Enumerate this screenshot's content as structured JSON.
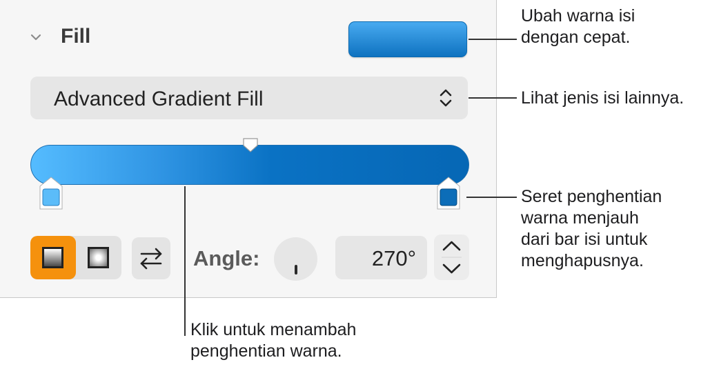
{
  "panel": {
    "section_title": "Fill",
    "fill_type": "Advanced Gradient Fill",
    "angle_label": "Angle:",
    "angle_value": "270°"
  },
  "colors": {
    "swatch_top": "#48aaf0",
    "swatch_bottom": "#0e72c0",
    "gradient_start": "#55bcff",
    "gradient_end": "#0667b5",
    "stop_left": "#5bbcf9",
    "stop_right": "#0c6db8",
    "selected_segment": "#f5910d"
  },
  "callouts": {
    "quick_fill": [
      "Ubah warna isi",
      "dengan cepat."
    ],
    "more_types": [
      "Lihat jenis isi lainnya."
    ],
    "remove_stop": [
      "Seret penghentian",
      "warna menjauh",
      "dari bar isi untuk",
      "menghapusnya."
    ],
    "add_stop": [
      "Klik untuk menambah",
      "penghentian warna."
    ]
  }
}
